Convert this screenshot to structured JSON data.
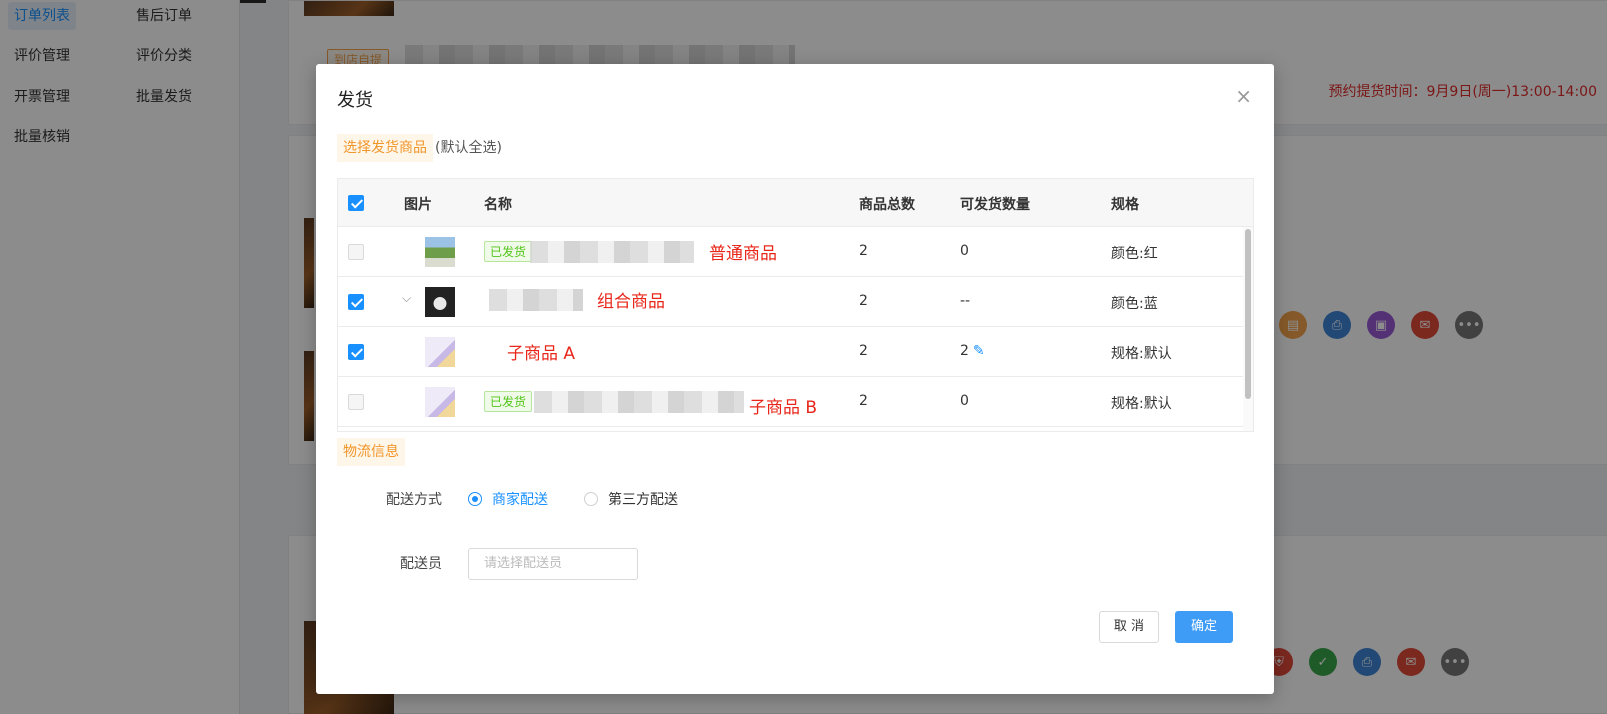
{
  "sidebar": {
    "items": [
      {
        "label": "订单列表",
        "active": true
      },
      {
        "label": "售后订单"
      },
      {
        "label": "评价管理"
      },
      {
        "label": "评价分类"
      },
      {
        "label": "开票管理"
      },
      {
        "label": "批量发货"
      },
      {
        "label": "批量核销"
      }
    ]
  },
  "background": {
    "pickup_tag": "到店自提",
    "pickup_time": "预约提货时间：9月9日(周一)13:00-14:00"
  },
  "modal": {
    "title": "发货",
    "close_icon": "×",
    "goods_section": {
      "tag": "选择发货商品",
      "hint": "(默认全选)"
    },
    "table": {
      "headers": {
        "image": "图片",
        "name": "名称",
        "total": "商品总数",
        "shippable": "可发货数量",
        "spec": "规格"
      },
      "rows": [
        {
          "checked": false,
          "shipped_tag": "已发货",
          "annotation": "普通商品",
          "total": "2",
          "shippable": "0",
          "spec": "颜色:红"
        },
        {
          "checked": true,
          "expand": "⌵",
          "annotation": "组合商品",
          "total": "2",
          "shippable": "--",
          "spec": "颜色:蓝"
        },
        {
          "checked": true,
          "annotation": "子商品 A",
          "total": "2",
          "shippable": "2",
          "spec": "规格:默认"
        },
        {
          "checked": false,
          "shipped_tag": "已发货",
          "annotation": "子商品 B",
          "total": "2",
          "shippable": "0",
          "spec": "规格:默认"
        }
      ]
    },
    "logistics_section": {
      "tag": "物流信息"
    },
    "delivery": {
      "label": "配送方式",
      "options": [
        {
          "label": "商家配送",
          "selected": true
        },
        {
          "label": "第三方配送",
          "selected": false
        }
      ]
    },
    "courier": {
      "label": "配送员",
      "placeholder": "请选择配送员"
    },
    "buttons": {
      "cancel": "取 消",
      "ok": "确定"
    }
  },
  "colors": {
    "accent": "#1890ff",
    "warn_tag": "#f0962a",
    "annotation": "#e8261a",
    "shipped": "#52c41a"
  }
}
